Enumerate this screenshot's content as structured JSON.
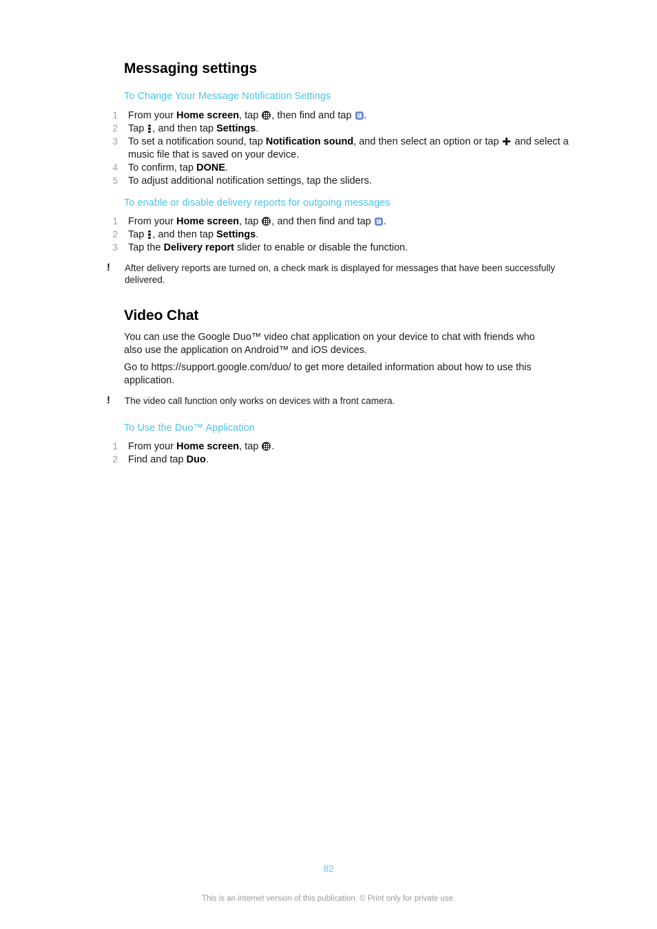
{
  "document": {
    "page_number": "82",
    "footer_note": "This is an internet version of this publication. © Print only for private use.",
    "accent_color": "#4EC3E8",
    "number_color": "#9d9d9d"
  },
  "sections": [
    {
      "id": "messaging-settings",
      "title": "Messaging settings",
      "tasks": [
        {
          "id": "change-message-notification-settings",
          "title": "To Change Your Message Notification Settings",
          "steps": [
            {
              "num": "1",
              "parts": [
                {
                  "type": "text",
                  "text": "From your "
                },
                {
                  "type": "bold",
                  "text": "Home screen"
                },
                {
                  "type": "text",
                  "text": ", tap "
                },
                {
                  "type": "icon",
                  "icon": "app-drawer-icon"
                },
                {
                  "type": "text",
                  "text": ", then find and tap "
                },
                {
                  "type": "icon",
                  "icon": "messaging-app-icon"
                },
                {
                  "type": "text",
                  "text": "."
                }
              ]
            },
            {
              "num": "2",
              "parts": [
                {
                  "type": "text",
                  "text": "Tap "
                },
                {
                  "type": "icon",
                  "icon": "overflow-menu-icon"
                },
                {
                  "type": "text",
                  "text": ", and then tap "
                },
                {
                  "type": "bold",
                  "text": "Settings"
                },
                {
                  "type": "text",
                  "text": "."
                }
              ]
            },
            {
              "num": "3",
              "parts": [
                {
                  "type": "text",
                  "text": "To set a notification sound, tap "
                },
                {
                  "type": "bold",
                  "text": "Notification sound"
                },
                {
                  "type": "text",
                  "text": ", and then select an option or tap "
                },
                {
                  "type": "icon",
                  "icon": "plus-icon"
                },
                {
                  "type": "text",
                  "text": " and select a music file that is saved on your device."
                }
              ]
            },
            {
              "num": "4",
              "parts": [
                {
                  "type": "text",
                  "text": "To confirm, tap "
                },
                {
                  "type": "bold",
                  "text": "DONE"
                },
                {
                  "type": "text",
                  "text": "."
                }
              ]
            },
            {
              "num": "5",
              "parts": [
                {
                  "type": "text",
                  "text": "To adjust additional notification settings, tap the sliders."
                }
              ]
            }
          ]
        },
        {
          "id": "delivery-reports",
          "title": "To enable or disable delivery reports for outgoing messages",
          "steps": [
            {
              "num": "1",
              "parts": [
                {
                  "type": "text",
                  "text": "From your "
                },
                {
                  "type": "bold",
                  "text": "Home screen"
                },
                {
                  "type": "text",
                  "text": ", tap "
                },
                {
                  "type": "icon",
                  "icon": "app-drawer-icon"
                },
                {
                  "type": "text",
                  "text": ", and then find and tap "
                },
                {
                  "type": "icon",
                  "icon": "messaging-app-icon"
                },
                {
                  "type": "text",
                  "text": "."
                }
              ]
            },
            {
              "num": "2",
              "parts": [
                {
                  "type": "text",
                  "text": "Tap "
                },
                {
                  "type": "icon",
                  "icon": "overflow-menu-icon"
                },
                {
                  "type": "text",
                  "text": ", and then tap "
                },
                {
                  "type": "bold",
                  "text": "Settings"
                },
                {
                  "type": "text",
                  "text": "."
                }
              ]
            },
            {
              "num": "3",
              "parts": [
                {
                  "type": "text",
                  "text": "Tap the "
                },
                {
                  "type": "bold",
                  "text": "Delivery report"
                },
                {
                  "type": "text",
                  "text": " slider to enable or disable the function."
                }
              ]
            }
          ],
          "note": "After delivery reports are turned on, a check mark is displayed for messages that have been successfully delivered."
        }
      ]
    },
    {
      "id": "video-chat",
      "title": "Video Chat",
      "paragraphs": [
        "You can use the Google Duo™ video chat application on your device to chat with friends who also use the application on Android™ and iOS devices.",
        "Go to https://support.google.com/duo/ to get more detailed information about how to use this application."
      ],
      "note": "The video call function only works on devices with a front camera.",
      "tasks": [
        {
          "id": "use-duo-application",
          "title": "To Use the Duo™ Application",
          "steps": [
            {
              "num": "1",
              "parts": [
                {
                  "type": "text",
                  "text": "From your "
                },
                {
                  "type": "bold",
                  "text": "Home screen"
                },
                {
                  "type": "text",
                  "text": ", tap "
                },
                {
                  "type": "icon",
                  "icon": "app-drawer-icon"
                },
                {
                  "type": "text",
                  "text": "."
                }
              ]
            },
            {
              "num": "2",
              "parts": [
                {
                  "type": "text",
                  "text": "Find and tap "
                },
                {
                  "type": "bold",
                  "text": "Duo"
                },
                {
                  "type": "text",
                  "text": "."
                }
              ]
            }
          ]
        }
      ]
    }
  ]
}
